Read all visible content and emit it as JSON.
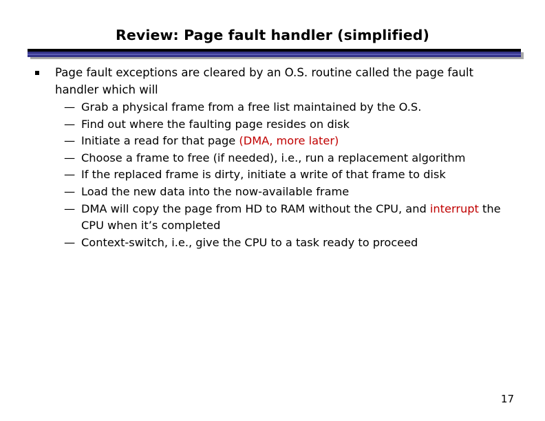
{
  "slide": {
    "title": "Review: Page fault handler (simplified)",
    "page_number": "17",
    "accent_color": "#333388",
    "highlight_color": "#c00000",
    "background_color": "#ffffff"
  },
  "content": {
    "bullet1": {
      "marker": "square-bullet",
      "text": "Page fault exceptions are cleared by an O.S. routine called the page fault handler which will"
    },
    "sub_bullets": [
      {
        "marker": "em-dash",
        "parts": [
          {
            "text": "Grab a physical frame from a free list maintained by the O.S.",
            "color": "normal"
          }
        ]
      },
      {
        "marker": "em-dash",
        "parts": [
          {
            "text": "Find out where the faulting page resides on disk",
            "color": "normal"
          }
        ]
      },
      {
        "marker": "em-dash",
        "parts": [
          {
            "text": "Initiate a read for that page ",
            "color": "normal"
          },
          {
            "text": "(DMA, more later)",
            "color": "red"
          }
        ]
      },
      {
        "marker": "em-dash",
        "parts": [
          {
            "text": "Choose a frame to free (if needed), i.e.,  run a replacement algorithm",
            "color": "normal"
          }
        ]
      },
      {
        "marker": "em-dash",
        "parts": [
          {
            "text": "If the replaced frame is dirty, initiate a write of that frame to disk",
            "color": "normal"
          }
        ]
      },
      {
        "marker": "em-dash",
        "parts": [
          {
            "text": "Load the new data into the now-available frame",
            "color": "normal"
          }
        ]
      },
      {
        "marker": "em-dash",
        "parts": [
          {
            "text": "DMA will copy the page from HD to RAM without the CPU, and ",
            "color": "normal"
          },
          {
            "text": "interrupt",
            "color": "red"
          },
          {
            "text": " the CPU when it’s completed",
            "color": "normal"
          }
        ]
      },
      {
        "marker": "em-dash",
        "parts": [
          {
            "text": "Context-switch, i.e., give the CPU to a task ready to proceed",
            "color": "normal"
          }
        ]
      }
    ]
  }
}
